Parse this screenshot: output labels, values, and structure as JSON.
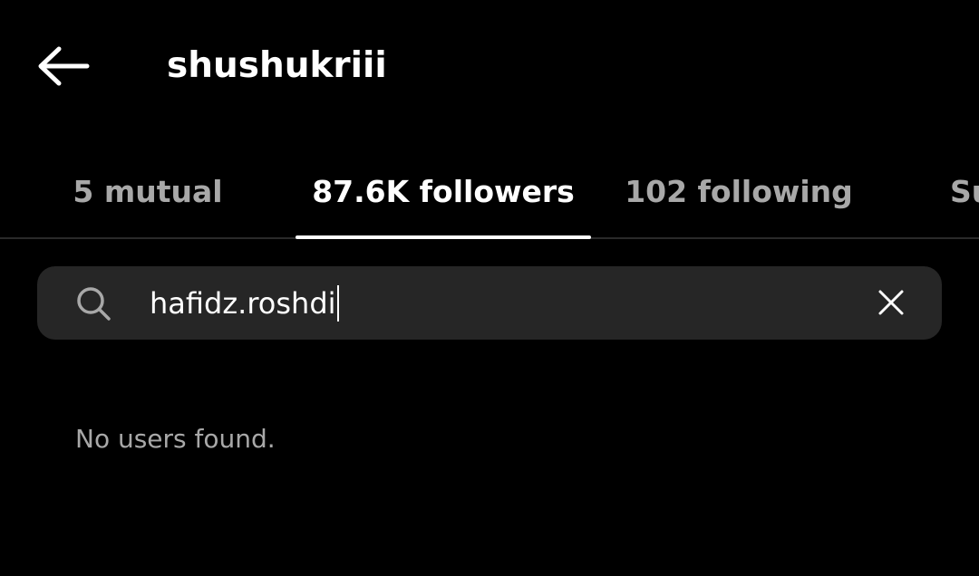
{
  "header": {
    "title": "shushukriii",
    "back_icon": "arrow-left-icon"
  },
  "tabs": [
    {
      "label": "5 mutual",
      "active": false
    },
    {
      "label": "87.6K followers",
      "active": true
    },
    {
      "label": "102 following",
      "active": false
    },
    {
      "label": "Su",
      "active": false
    }
  ],
  "search": {
    "value": "hafidz.roshdi",
    "search_icon": "search-icon",
    "clear_icon": "close-icon"
  },
  "results": {
    "empty_message": "No users found."
  },
  "colors": {
    "background": "#000000",
    "search_background": "#262626",
    "primary_text": "#ffffff",
    "secondary_text": "#a8a8a8",
    "divider": "#2a2a2a"
  }
}
